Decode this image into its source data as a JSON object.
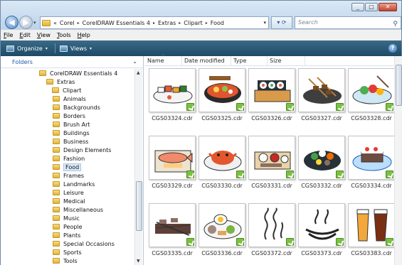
{
  "window": {
    "buttons": [
      "_",
      "□",
      "✕"
    ]
  },
  "nav": {
    "back_glyph": "◀",
    "forward_glyph": "▶",
    "dropdown_glyph": "▾"
  },
  "address": {
    "overflow": "«",
    "crumbs": [
      "Corel",
      "CorelDRAW Essentials 4",
      "Extras",
      "Clipart",
      "Food"
    ],
    "separator": "▸",
    "dropdown_glyph": "▾",
    "refresh_glyph": "▾ ⟳"
  },
  "search": {
    "placeholder": "Search",
    "icon": "search-icon"
  },
  "menu": [
    "File",
    "Edit",
    "View",
    "Tools",
    "Help"
  ],
  "toolbar": {
    "organize": "Organize",
    "views": "Views",
    "caret": "▾",
    "help": "?"
  },
  "folders": {
    "title": "Folders",
    "chevron": "⌄",
    "tree": [
      {
        "label": "CorelDRAW Essentials 4",
        "indent": 0
      },
      {
        "label": "Extras",
        "indent": 1
      },
      {
        "label": "Clipart",
        "indent": 2
      },
      {
        "label": "Animals",
        "indent": 3
      },
      {
        "label": "Backgrounds",
        "indent": 3
      },
      {
        "label": "Borders",
        "indent": 3
      },
      {
        "label": "Brush Art",
        "indent": 3
      },
      {
        "label": "Buildings",
        "indent": 3
      },
      {
        "label": "Business",
        "indent": 3
      },
      {
        "label": "Design Elements",
        "indent": 3
      },
      {
        "label": "Fashion",
        "indent": 3
      },
      {
        "label": "Food",
        "indent": 3,
        "selected": true
      },
      {
        "label": "Frames",
        "indent": 3
      },
      {
        "label": "Landmarks",
        "indent": 3
      },
      {
        "label": "Leisure",
        "indent": 3
      },
      {
        "label": "Medical",
        "indent": 3
      },
      {
        "label": "Miscellaneous",
        "indent": 3
      },
      {
        "label": "Music",
        "indent": 3
      },
      {
        "label": "People",
        "indent": 3
      },
      {
        "label": "Plants",
        "indent": 3
      },
      {
        "label": "Special Occasions",
        "indent": 3
      },
      {
        "label": "Sports",
        "indent": 3
      },
      {
        "label": "Tools",
        "indent": 3
      }
    ]
  },
  "columns": [
    "Name",
    "Date modified",
    "Type",
    "Size"
  ],
  "sort_glyph": "^",
  "files": [
    {
      "name": "CGS03324.cdr",
      "art": "sushi-plate"
    },
    {
      "name": "CGS03325.cdr",
      "art": "bento-bowl"
    },
    {
      "name": "CGS03326.cdr",
      "art": "sushi-roll"
    },
    {
      "name": "CGS03327.cdr",
      "art": "skewers"
    },
    {
      "name": "CGS03328.cdr",
      "art": "salad-platter"
    },
    {
      "name": "CGS03329.cdr",
      "art": "fish-on-board"
    },
    {
      "name": "CGS03330.cdr",
      "art": "crab-platter"
    },
    {
      "name": "CGS03331.cdr",
      "art": "tray-of-dishes"
    },
    {
      "name": "CGS03332.cdr",
      "art": "hot-pot"
    },
    {
      "name": "CGS03334.cdr",
      "art": "cake-dish"
    },
    {
      "name": "CGS03335.cdr",
      "art": "grilled-meat"
    },
    {
      "name": "CGS03336.cdr",
      "art": "breakfast-platter"
    },
    {
      "name": "CGS03372.cdr",
      "art": "steam-lines"
    },
    {
      "name": "CGS03373.cdr",
      "art": "steam-bowl"
    },
    {
      "name": "CGS03383.cdr",
      "art": "beer-glasses"
    }
  ]
}
